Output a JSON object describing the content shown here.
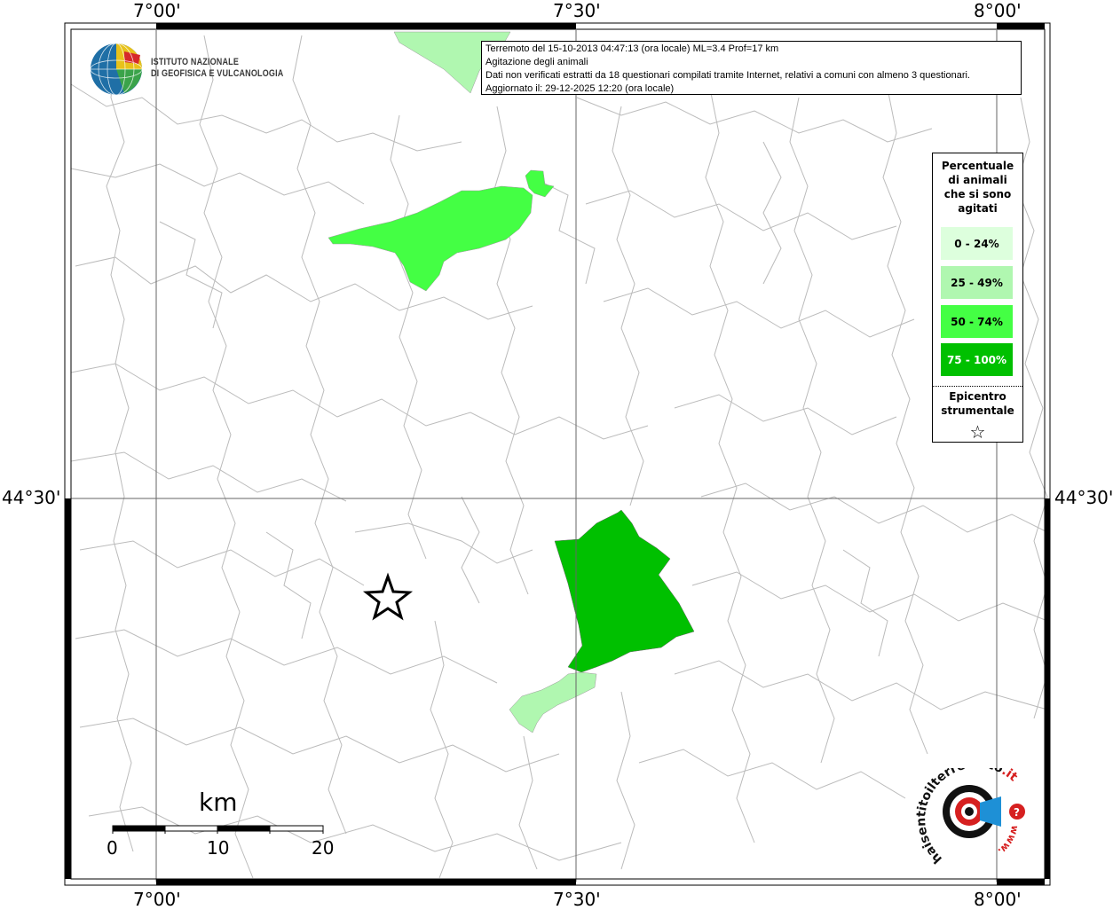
{
  "map": {
    "coordinates": {
      "top": [
        "7°00'",
        "7°30'",
        "8°00'"
      ],
      "bottom": [
        "7°00'",
        "7°30'",
        "8°00'"
      ],
      "left": "44°30'",
      "right": "44°30'"
    },
    "colors": {
      "class_0_24": "#ddffdd",
      "class_25_49": "#b0f7b0",
      "class_50_74": "#44ff44",
      "class_75_100": "#00c000",
      "boundary": "#bbbbbb"
    }
  },
  "logo": {
    "line1": "ISTITUTO NAZIONALE",
    "line2": "DI GEOFISICA E VULCANOLOGIA"
  },
  "info": {
    "line1": "Terremoto del 15-10-2013 04:47:13 (ora locale) ML=3.4 Prof=17 km",
    "line2": "Agitazione degli animali",
    "line3": "Dati non verificati estratti da 18 questionari compilati tramite Internet, relativi a comuni con almeno 3 questionari.",
    "line4": "Aggiornato il: 29-12-2025 12:20 (ora locale)"
  },
  "legend": {
    "title_l1": "Percentuale",
    "title_l2": "di animali",
    "title_l3": "che si sono",
    "title_l4": "agitati",
    "classes": [
      {
        "label": "0 - 24%",
        "color": "#ddffdd"
      },
      {
        "label": "25 - 49%",
        "color": "#b0f7b0"
      },
      {
        "label": "50 - 74%",
        "color": "#44ff44"
      },
      {
        "label": "75 - 100%",
        "color": "#00c000"
      }
    ],
    "epicenter_l1": "Epicentro",
    "epicenter_l2": "strumentale",
    "star": "☆"
  },
  "scale": {
    "unit": "km",
    "ticks": [
      "0",
      "10",
      "20"
    ]
  },
  "hsi_logo": {
    "text_main": "haisentitoilterremoto",
    "text_accent": ".it",
    "text_www": "www.",
    "question": "?"
  }
}
